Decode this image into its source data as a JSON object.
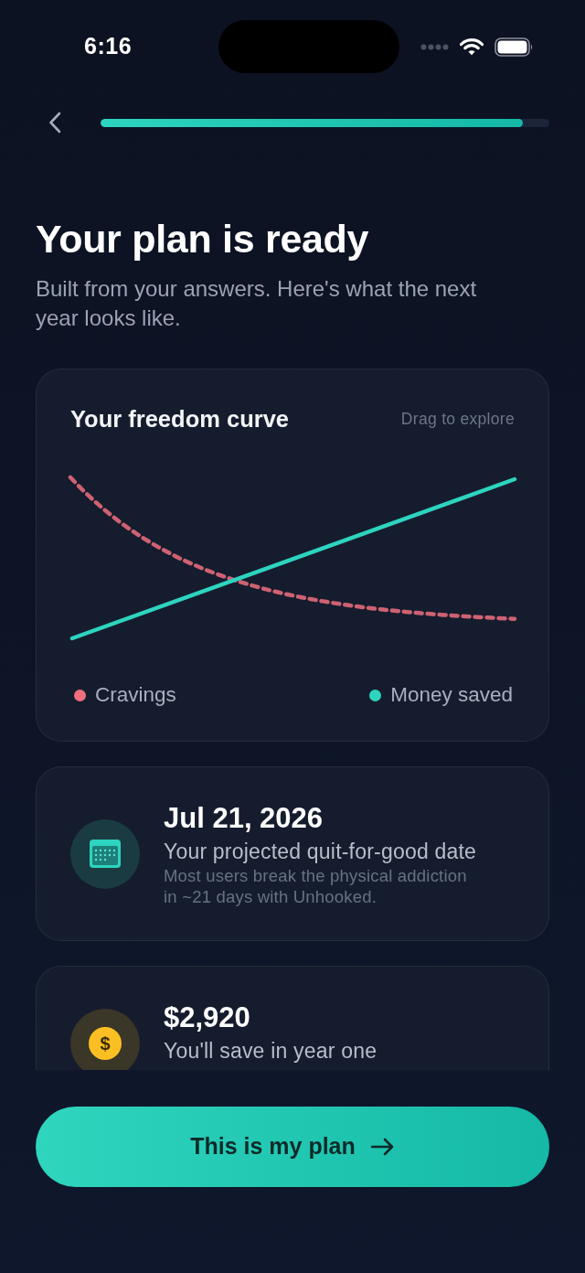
{
  "status_bar": {
    "time": "6:16"
  },
  "progress": {
    "level": 0.94
  },
  "title": "Your plan is ready",
  "subtitle": "Built from your answers. Here's what the next year looks like.",
  "chart": {
    "title": "Your freedom curve",
    "hint": "Drag to explore",
    "legend": [
      {
        "label": "Cravings",
        "color": "#ee6f7f",
        "kind": "dashed"
      },
      {
        "label": "Money saved",
        "color": "#2dd4bf",
        "kind": "solid"
      }
    ]
  },
  "stats": [
    {
      "kind": "calendar",
      "value": "Jul 21, 2026",
      "label": "Your projected quit-for-good date",
      "note": "Most users break the physical addiction in ~21 days with Unhooked."
    },
    {
      "kind": "coin",
      "symbol": "$",
      "value": "$2,920",
      "label": "You'll save in year one"
    }
  ],
  "button": {
    "label": "This is my plan"
  }
}
